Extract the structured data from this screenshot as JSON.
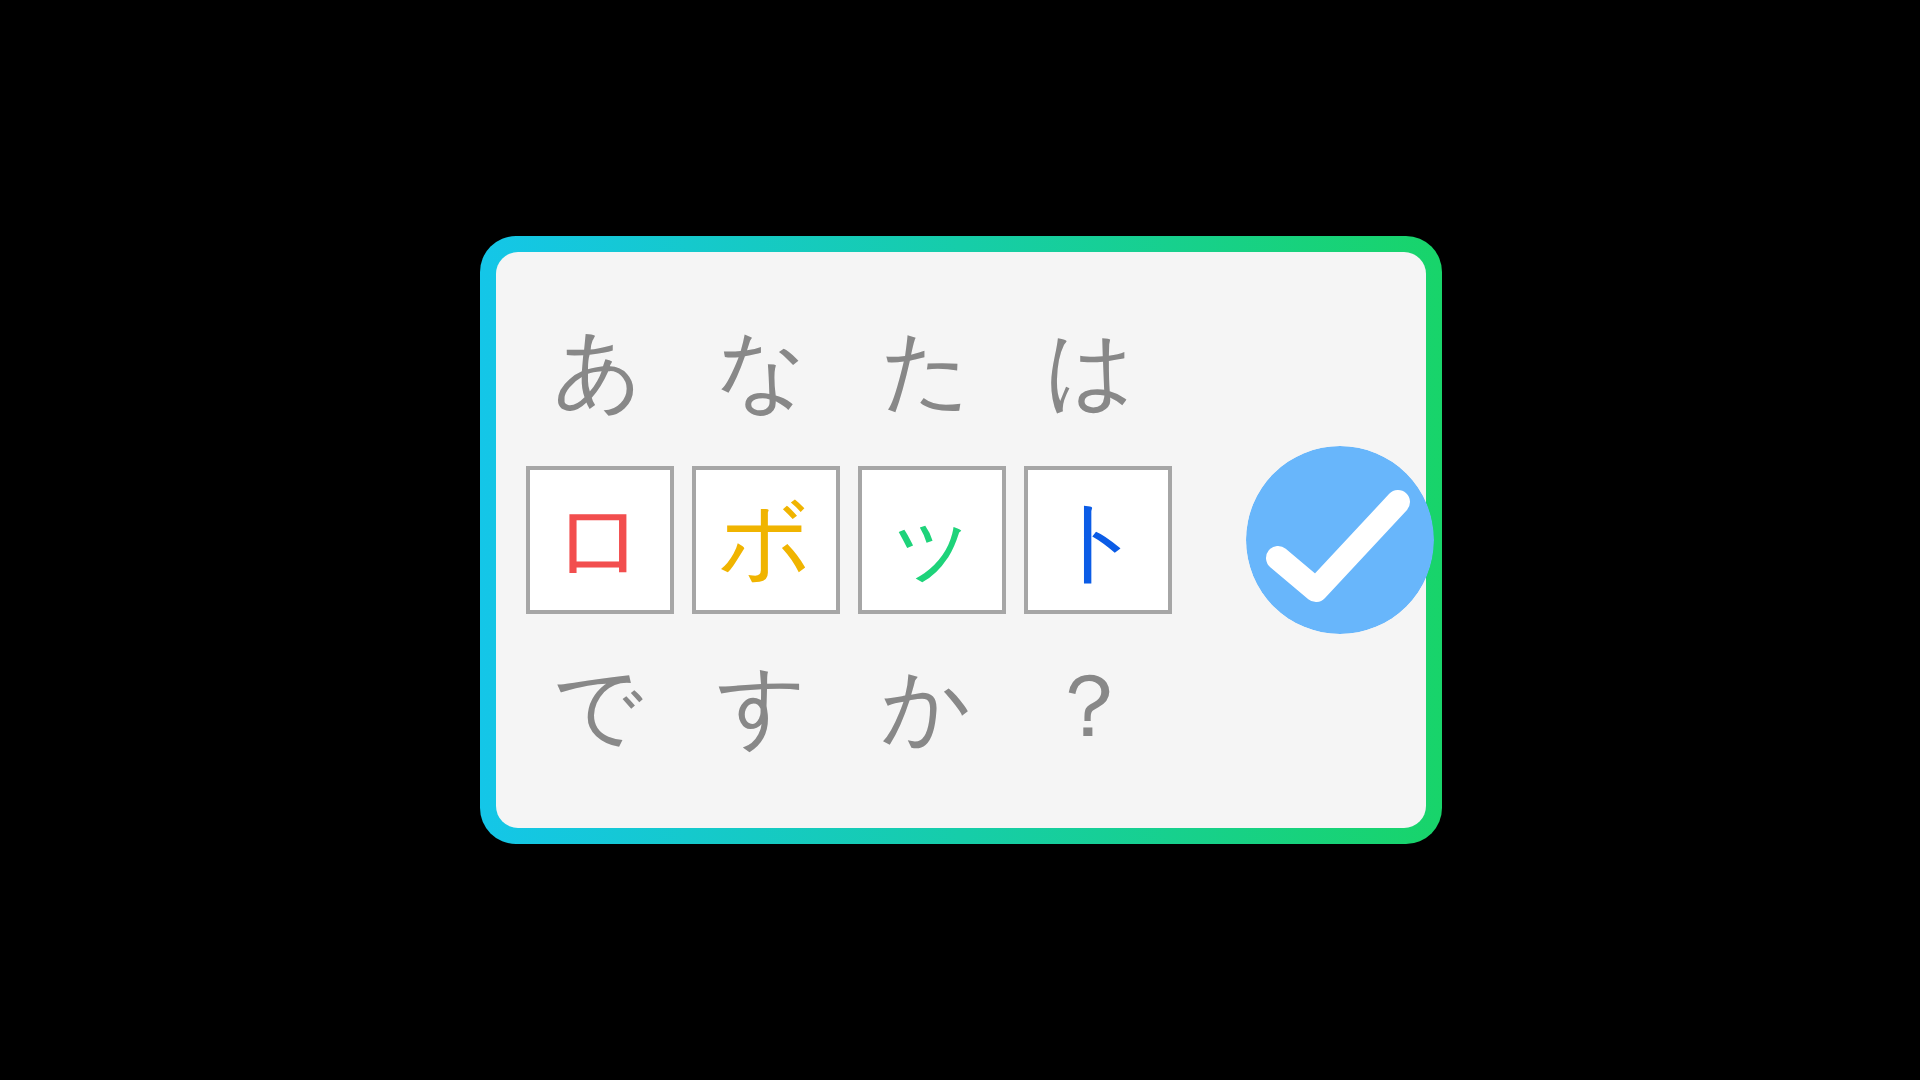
{
  "question": {
    "line_1": "あなたは",
    "tiles": [
      {
        "text": "ロ",
        "color": "#f24e4e"
      },
      {
        "text": "ボ",
        "color": "#f0b400"
      },
      {
        "text": "ッ",
        "color": "#1ed37a"
      },
      {
        "text": "ト",
        "color": "#0b5ce6"
      }
    ],
    "line_2": "ですか？"
  },
  "checkbox": {
    "checked": true
  }
}
